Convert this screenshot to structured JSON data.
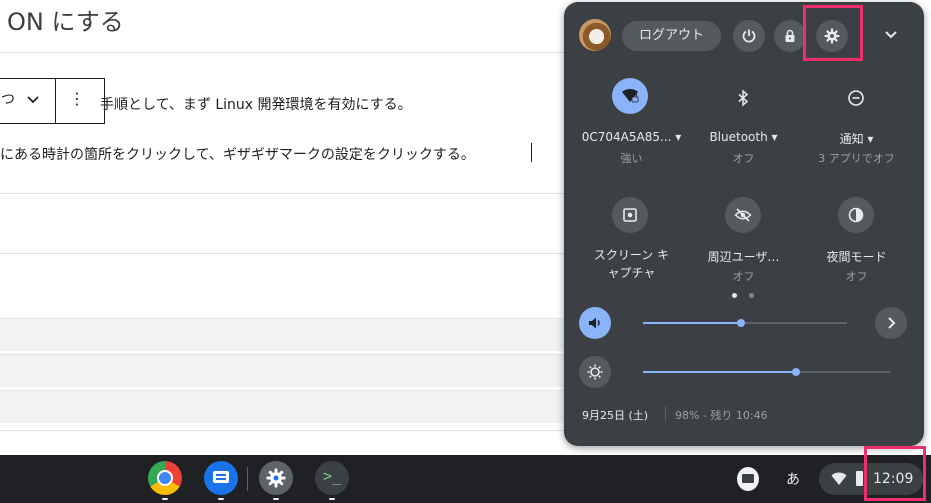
{
  "page": {
    "heading": "ON にする",
    "toolbar_edge_text": "つ",
    "paragraph1": "手順として、まず Linux 開発環境を有効にする。",
    "paragraph2": "にある時計の箇所をクリックして、ギザギザマークの設定をクリックする。"
  },
  "quick_settings": {
    "signout_label": "ログアウト",
    "tiles": [
      {
        "label": "0C704A5A85...",
        "sub": "強い",
        "icon": "wifi-locked-icon",
        "active": true,
        "has_menu": true
      },
      {
        "label": "Bluetooth",
        "sub": "オフ",
        "icon": "bluetooth-icon",
        "active": false,
        "has_menu": true
      },
      {
        "label": "通知",
        "sub": "3 アプリでオフ",
        "icon": "do-not-disturb-icon",
        "active": false,
        "has_menu": true
      },
      {
        "label": "スクリーン キ\nャプチャ",
        "sub": "",
        "icon": "screen-capture-icon",
        "active": false,
        "has_menu": false
      },
      {
        "label": "周辺ユーザ…",
        "sub": "オフ",
        "icon": "privacy-eye-off-icon",
        "active": false,
        "has_menu": false
      },
      {
        "label": "夜間モード",
        "sub": "オフ",
        "icon": "night-light-icon",
        "active": false,
        "has_menu": false
      }
    ],
    "page_indicator": {
      "pages": 2,
      "current": 1
    },
    "volume_level": 0.48,
    "brightness_level": 0.62,
    "date": "9月25日 (土)",
    "battery": "98% - 残り 10:46"
  },
  "shelf": {
    "apps": [
      "chrome-icon",
      "messages-icon",
      "settings-app-icon",
      "terminal-icon"
    ],
    "ime_label": "あ",
    "time": "12:09"
  },
  "colors": {
    "panel_bg": "#3c3f43",
    "button_bg": "#56595d",
    "accent": "#8ab4f8",
    "highlight": "#ee2f6b",
    "shelf_bg": "#202124"
  }
}
